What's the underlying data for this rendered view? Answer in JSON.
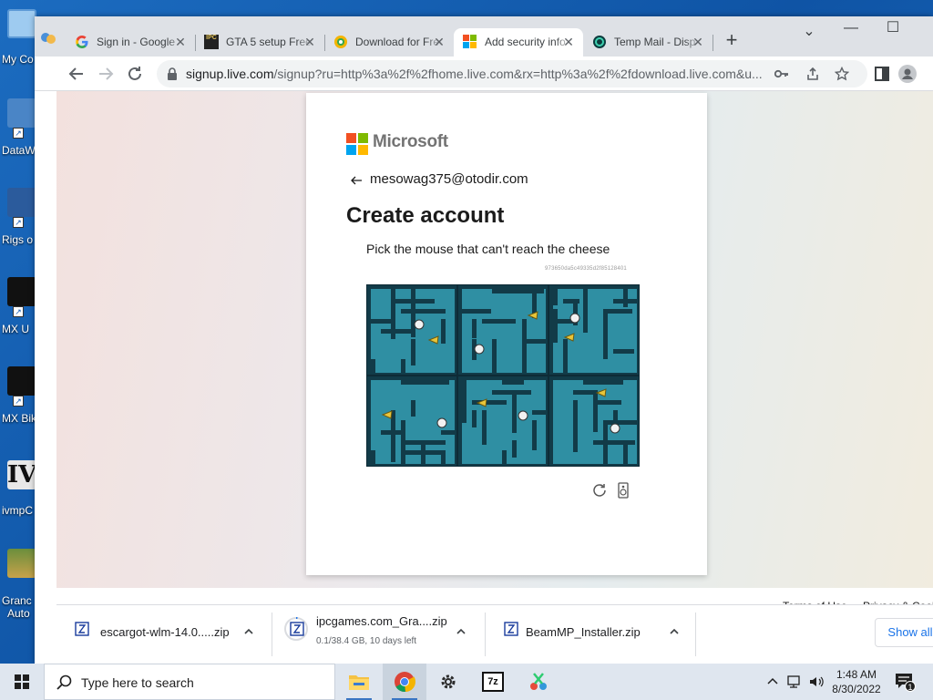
{
  "desktop": {
    "icons": [
      {
        "label": "My Co",
        "name": "my-computer"
      },
      {
        "label": "DataW",
        "name": "datawrapper"
      },
      {
        "label": "Rigs o",
        "name": "rigs-of-rods"
      },
      {
        "label": "MX U",
        "name": "mx-unleashed"
      },
      {
        "label": "MX Bik",
        "name": "mx-bikes"
      },
      {
        "label": "ivmpC",
        "name": "ivmp"
      },
      {
        "label": "Granc",
        "label2": "Auto",
        "name": "grand-theft-auto"
      }
    ]
  },
  "browser": {
    "tabs": [
      {
        "title": "Sign in - Google",
        "icon": "google-icon"
      },
      {
        "title": "GTA 5 setup Free",
        "icon": "ipc-games-icon"
      },
      {
        "title": "Download for Free",
        "icon": "download-site-icon"
      },
      {
        "title": "Add security info",
        "icon": "microsoft-icon",
        "active": true
      },
      {
        "title": "Temp Mail - Disp",
        "icon": "temp-mail-icon"
      }
    ],
    "new_tab": "+",
    "url_host": "signup.live.com",
    "url_rest": "/signup?ru=http%3a%2f%2fhome.live.com&rx=http%3a%2f%2fdownload.live.com&u..."
  },
  "page": {
    "brand": "Microsoft",
    "identity": "mesowag375@otodir.com",
    "title": "Create account",
    "prompt": "Pick the mouse that can't reach the cheese",
    "challenge_id": "973650da5c49335d2f85128401",
    "footer": {
      "terms": "Terms of Use",
      "privacy": "Privacy & Cookies"
    }
  },
  "downloads": {
    "items": [
      {
        "name": "escargot-wlm-14.0.....zip",
        "status": ""
      },
      {
        "name": "ipcgames.com_Gra....zip",
        "status": "0.1/38.4 GB, 10 days left",
        "progress": 0.003
      },
      {
        "name": "BeamMP_Installer.zip",
        "status": ""
      }
    ],
    "show_all": "Show all"
  },
  "taskbar": {
    "search_placeholder": "Type here to search",
    "time": "1:48 AM",
    "date": "8/30/2022",
    "notification_count": "1"
  },
  "colors": {
    "accent_blue": "#1a73e8",
    "ms_red": "#f25022",
    "ms_green": "#7fba00",
    "ms_blue": "#00a4ef",
    "ms_yellow": "#ffb900",
    "maze_teal": "#2f8fa3"
  }
}
